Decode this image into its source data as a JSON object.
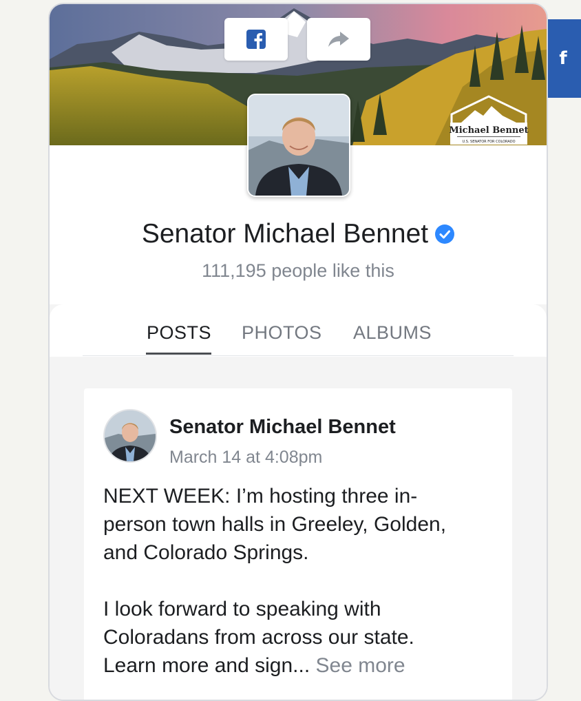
{
  "side_tab": {
    "icon": "facebook-f-icon",
    "label": "f"
  },
  "cover": {
    "share_buttons": [
      {
        "name": "facebook-share",
        "icon": "facebook-square-icon"
      },
      {
        "name": "share",
        "icon": "share-arrow-icon"
      }
    ],
    "badge": {
      "title": "Michael Bennet",
      "subtitle": "U.S. SENATOR FOR COLORADO"
    }
  },
  "page": {
    "name": "Senator Michael Bennet",
    "verified_icon": "verified-check-icon",
    "likes_count": "111,195",
    "likes_suffix": "people like this"
  },
  "tabs": [
    {
      "label": "POSTS",
      "active": true
    },
    {
      "label": "PHOTOS",
      "active": false
    },
    {
      "label": "ALBUMS",
      "active": false
    }
  ],
  "post": {
    "author": "Senator Michael Bennet",
    "timestamp": "March 14 at 4:08pm",
    "paragraph1_lines": [
      "NEXT WEEK: I’m hosting three in-",
      "person town halls in Greeley, Golden,",
      "and Colorado Springs."
    ],
    "paragraph2_lines": [
      "I look forward to speaking with",
      "Coloradans from across our state."
    ],
    "last_line": "Learn more and sign...",
    "see_more": "See more"
  },
  "colors": {
    "facebook_blue": "#2a5db0",
    "verified_blue": "#2d88ff",
    "muted_text": "#80868f"
  }
}
